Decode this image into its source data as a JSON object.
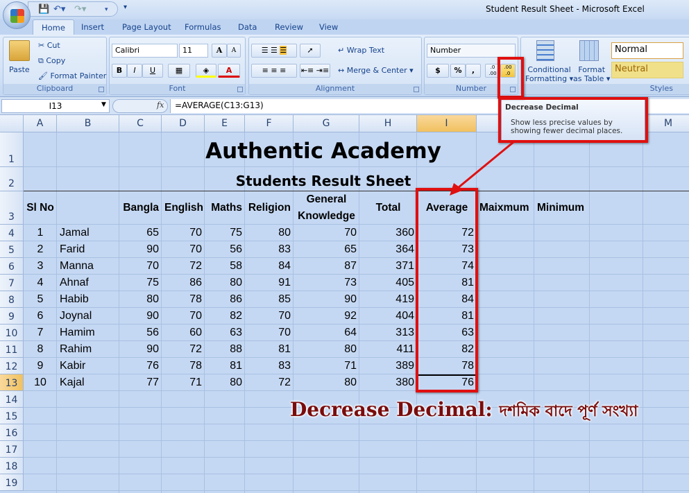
{
  "window": {
    "title": "Student Result Sheet - Microsoft Excel"
  },
  "tabs": [
    "Home",
    "Insert",
    "Page Layout",
    "Formulas",
    "Data",
    "Review",
    "View"
  ],
  "ribbon": {
    "clipboard": {
      "label": "Clipboard",
      "paste": "Paste",
      "cut": "Cut",
      "copy": "Copy",
      "format_painter": "Format Painter"
    },
    "font": {
      "label": "Font",
      "name": "Calibri",
      "size": "11",
      "bold": "B",
      "italic": "I",
      "underline": "U",
      "grow": "A",
      "shrink": "A",
      "color_letter": "A"
    },
    "alignment": {
      "label": "Alignment",
      "wrap_text": "Wrap Text",
      "merge_center": "Merge & Center"
    },
    "number": {
      "label": "Number",
      "format": "Number",
      "currency": "$",
      "percent": "%",
      "comma": ",",
      "increase_decimal": ".0 .00",
      "decrease_decimal": ".00 .0"
    },
    "styles": {
      "label": "Styles",
      "conditional": "Conditional",
      "conditional2": "Formatting",
      "format_table": "Format",
      "format_table2": "as Table",
      "normal": "Normal",
      "neutral": "Neutral"
    }
  },
  "formula_bar": {
    "name_box": "I13",
    "fx": "fx",
    "formula": "=AVERAGE(C13:G13)"
  },
  "tooltip": {
    "title": "Decrease Decimal",
    "body": "Show less precise values by showing fewer decimal places."
  },
  "columns": [
    "A",
    "B",
    "C",
    "D",
    "E",
    "F",
    "G",
    "H",
    "I",
    "J",
    "K",
    "L",
    "M"
  ],
  "rows": [
    "1",
    "2",
    "3",
    "4",
    "5",
    "6",
    "7",
    "8",
    "9",
    "10",
    "11",
    "12",
    "13",
    "14",
    "15",
    "16",
    "17",
    "18",
    "19"
  ],
  "selected_cell": "I13",
  "sheet": {
    "title": "Authentic Academy",
    "subtitle": "Students Result Sheet",
    "headers": {
      "sl": "Sl No",
      "bangla": "Bangla",
      "english": "English",
      "maths": "Maths",
      "religion": "Religion",
      "gk1": "General",
      "gk2": "Knowledge",
      "total": "Total",
      "average": "Average",
      "max": "Maixmum",
      "min": "Minimum"
    },
    "records": [
      [
        "1",
        "Jamal",
        "65",
        "70",
        "75",
        "80",
        "70",
        "360",
        "72"
      ],
      [
        "2",
        "Farid",
        "90",
        "70",
        "56",
        "83",
        "65",
        "364",
        "73"
      ],
      [
        "3",
        "Manna",
        "70",
        "72",
        "58",
        "84",
        "87",
        "371",
        "74"
      ],
      [
        "4",
        "Ahnaf",
        "75",
        "86",
        "80",
        "91",
        "73",
        "405",
        "81"
      ],
      [
        "5",
        "Habib",
        "80",
        "78",
        "86",
        "85",
        "90",
        "419",
        "84"
      ],
      [
        "6",
        "Joynal",
        "90",
        "70",
        "82",
        "70",
        "92",
        "404",
        "81"
      ],
      [
        "7",
        "Hamim",
        "56",
        "60",
        "63",
        "70",
        "64",
        "313",
        "63"
      ],
      [
        "8",
        "Rahim",
        "90",
        "72",
        "88",
        "81",
        "80",
        "411",
        "82"
      ],
      [
        "9",
        "Kabir",
        "76",
        "78",
        "81",
        "83",
        "71",
        "389",
        "78"
      ],
      [
        "10",
        "Kajal",
        "77",
        "71",
        "80",
        "72",
        "80",
        "380",
        "76"
      ]
    ]
  },
  "annotation": {
    "english": "Decrease Decimal:",
    "bangla": "দশমিক বাদে পূর্ণ সংখ্যা"
  },
  "colors": {
    "highlight": "#e01010",
    "selected_header": "#f1c15f",
    "annotation": "#7a0c0c",
    "grid_bg": "#c5d8f3"
  }
}
